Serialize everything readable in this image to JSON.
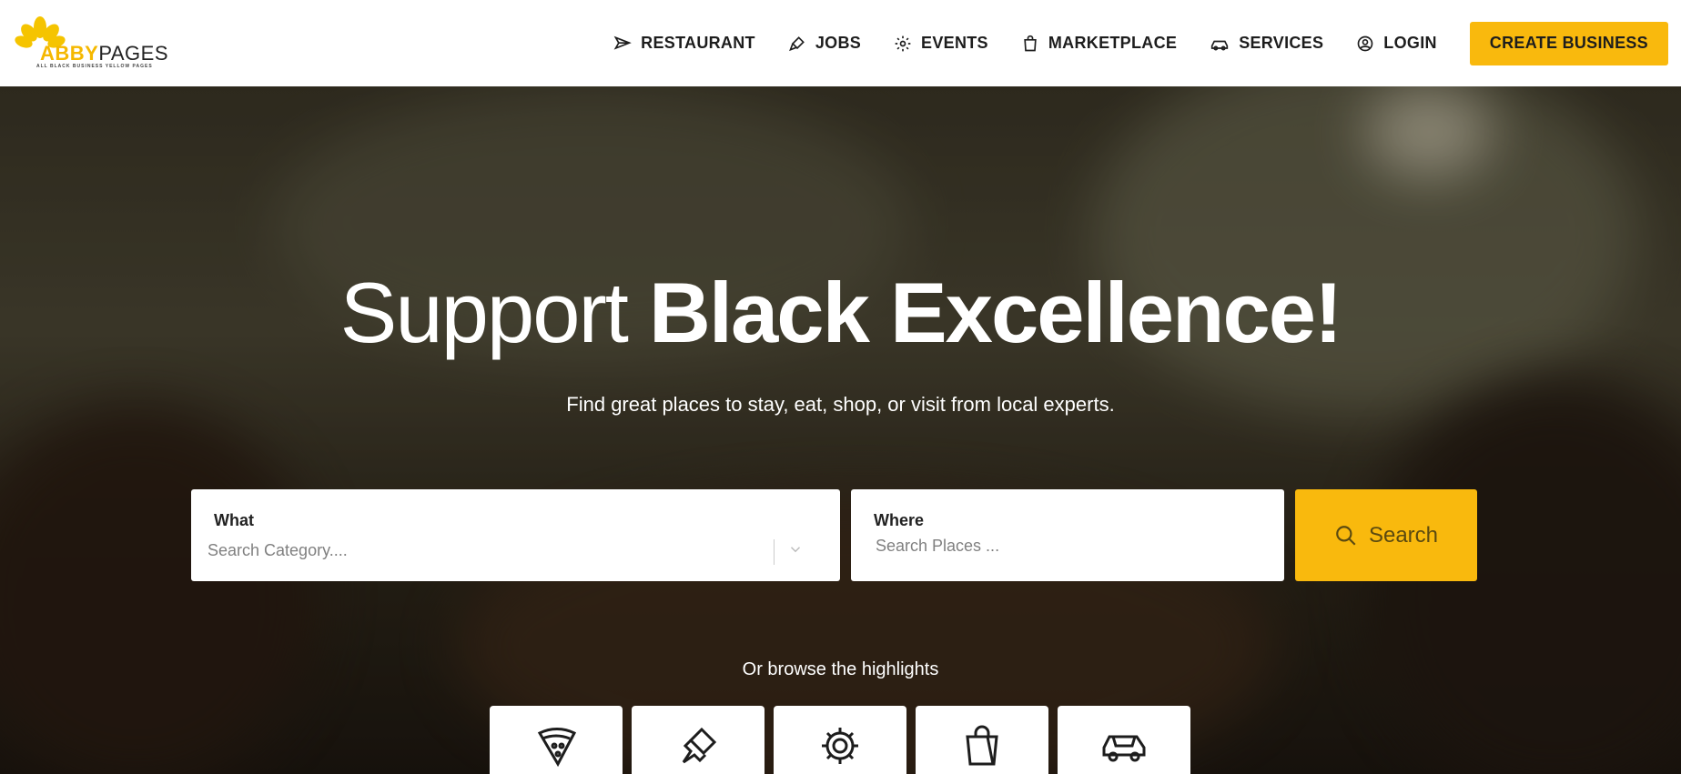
{
  "brand": {
    "name_part1": "ABBY",
    "name_part2": "PAGES",
    "tagline": "ALL BLACK BUSINESS YELLOW PAGES",
    "accent": "#f9b90d"
  },
  "nav": {
    "items": [
      {
        "label": "RESTAURANT",
        "icon": "paper-plane-icon"
      },
      {
        "label": "JOBS",
        "icon": "paint-brush-icon"
      },
      {
        "label": "EVENTS",
        "icon": "gear-icon"
      },
      {
        "label": "MARKETPLACE",
        "icon": "shopping-bag-icon"
      },
      {
        "label": "SERVICES",
        "icon": "car-icon"
      },
      {
        "label": "LOGIN",
        "icon": "user-circle-icon"
      }
    ],
    "cta": "CREATE BUSINESS"
  },
  "hero": {
    "headline_light": "Support ",
    "headline_bold": "Black Excellence!",
    "subheadline": "Find great places to stay, eat, shop, or visit from local experts."
  },
  "search": {
    "what_label": "What",
    "what_placeholder": "Search Category....",
    "where_label": "Where",
    "where_placeholder": "Search Places ...",
    "button_label": "Search"
  },
  "browse": {
    "title": "Or browse the highlights",
    "categories": [
      {
        "icon": "pizza-icon"
      },
      {
        "icon": "paint-brush-icon"
      },
      {
        "icon": "gear-icon"
      },
      {
        "icon": "shopping-bag-icon"
      },
      {
        "icon": "car-icon"
      }
    ]
  }
}
